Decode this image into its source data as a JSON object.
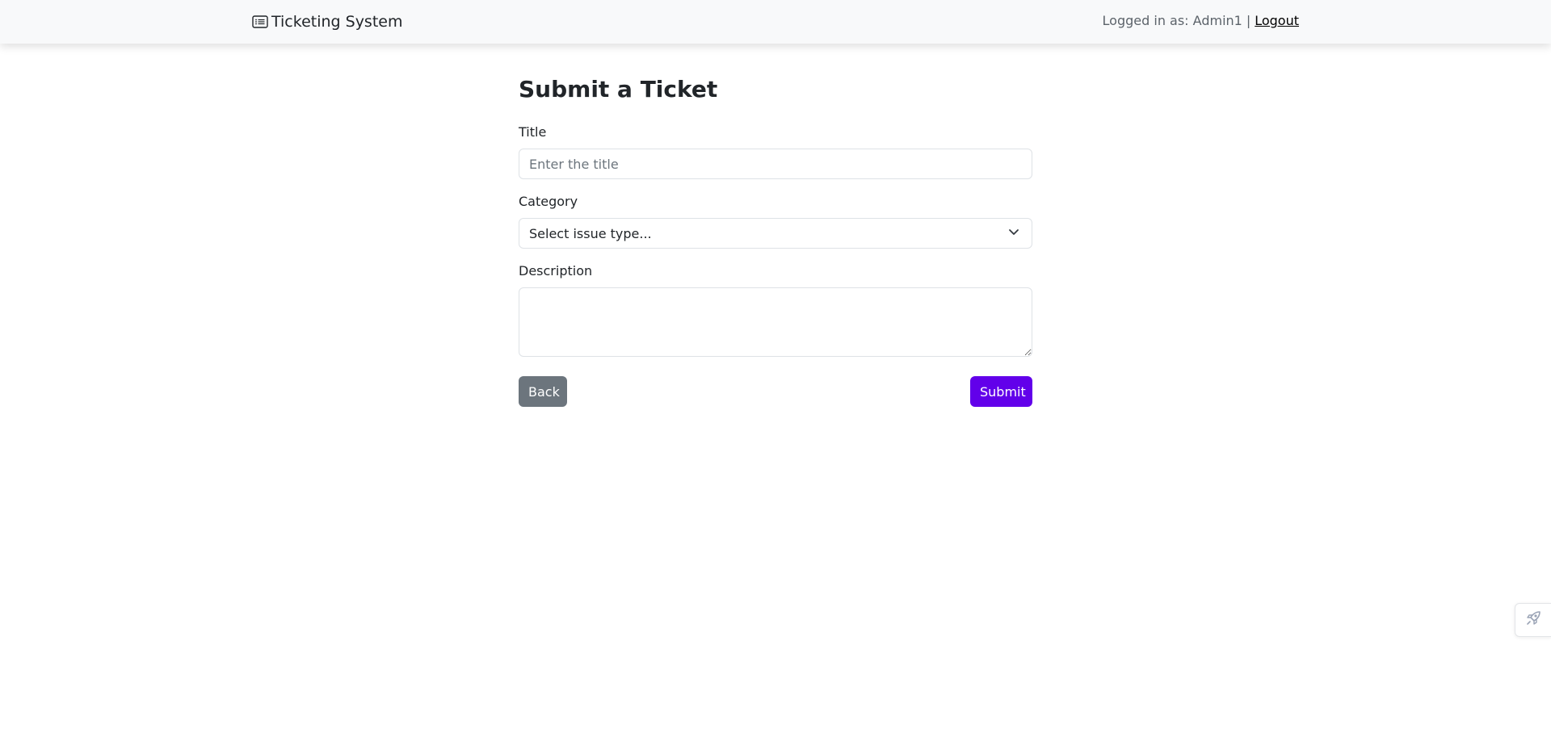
{
  "navbar": {
    "brand_icon": "card-list-icon",
    "brand_text": "Ticketing System",
    "logged_in_text": "Logged in as: Admin1",
    "separator": "|",
    "logout_label": "Logout"
  },
  "form": {
    "heading": "Submit a Ticket",
    "title_label": "Title",
    "title_value": "",
    "title_placeholder": "Enter the title",
    "category_label": "Category",
    "category_selected": "Select issue type...",
    "category_icon": "chevron-down-icon",
    "description_label": "Description",
    "description_value": "",
    "back_label": "Back",
    "submit_label": "Submit"
  },
  "widget": {
    "icon": "rocket-icon"
  },
  "colors": {
    "navbar_bg": "#f8f9fa",
    "back_button": "#6c757d",
    "submit_button": "#6200ea",
    "text": "#212529",
    "muted_text": "#5c636a"
  }
}
